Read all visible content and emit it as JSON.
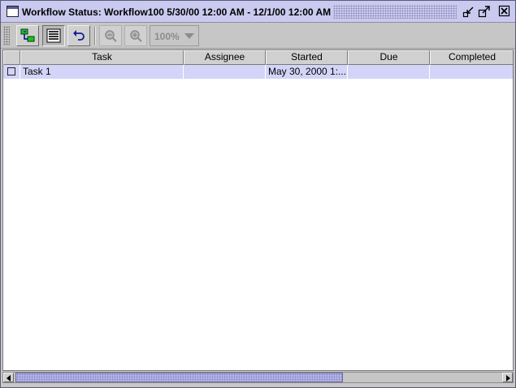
{
  "window": {
    "title": "Workflow Status: Workflow100 5/30/00 12:00 AM - 12/1/00 12:00 AM",
    "icons": [
      "window-icon",
      "minimize-icon",
      "maximize-icon",
      "close-icon"
    ]
  },
  "toolbar": {
    "buttons": [
      {
        "name": "graph-view-button",
        "icon": "workflow-graph-icon",
        "state": "raised"
      },
      {
        "name": "list-view-button",
        "icon": "list-icon",
        "state": "pressed"
      },
      {
        "name": "undo-button",
        "icon": "undo-arrow-icon",
        "state": "raised"
      },
      {
        "name": "zoom-out-button",
        "icon": "zoom-out-icon",
        "state": "disabled"
      },
      {
        "name": "zoom-in-button",
        "icon": "zoom-in-icon",
        "state": "disabled"
      }
    ],
    "zoom_value": "100%"
  },
  "table": {
    "columns": [
      "",
      "Task",
      "Assignee",
      "Started",
      "Due",
      "Completed"
    ],
    "rows": [
      {
        "checked": false,
        "task": "Task 1",
        "assignee": "",
        "started": "May 30, 2000 1:...",
        "due": "",
        "completed": ""
      }
    ],
    "selected_row_color": "#d4d4f8"
  },
  "colors": {
    "titlebar": "#cacaf0",
    "toolbar": "#c6c6c6",
    "scroll_thumb": "#b4b4e8",
    "disabled_text": "#8c8c8c"
  }
}
